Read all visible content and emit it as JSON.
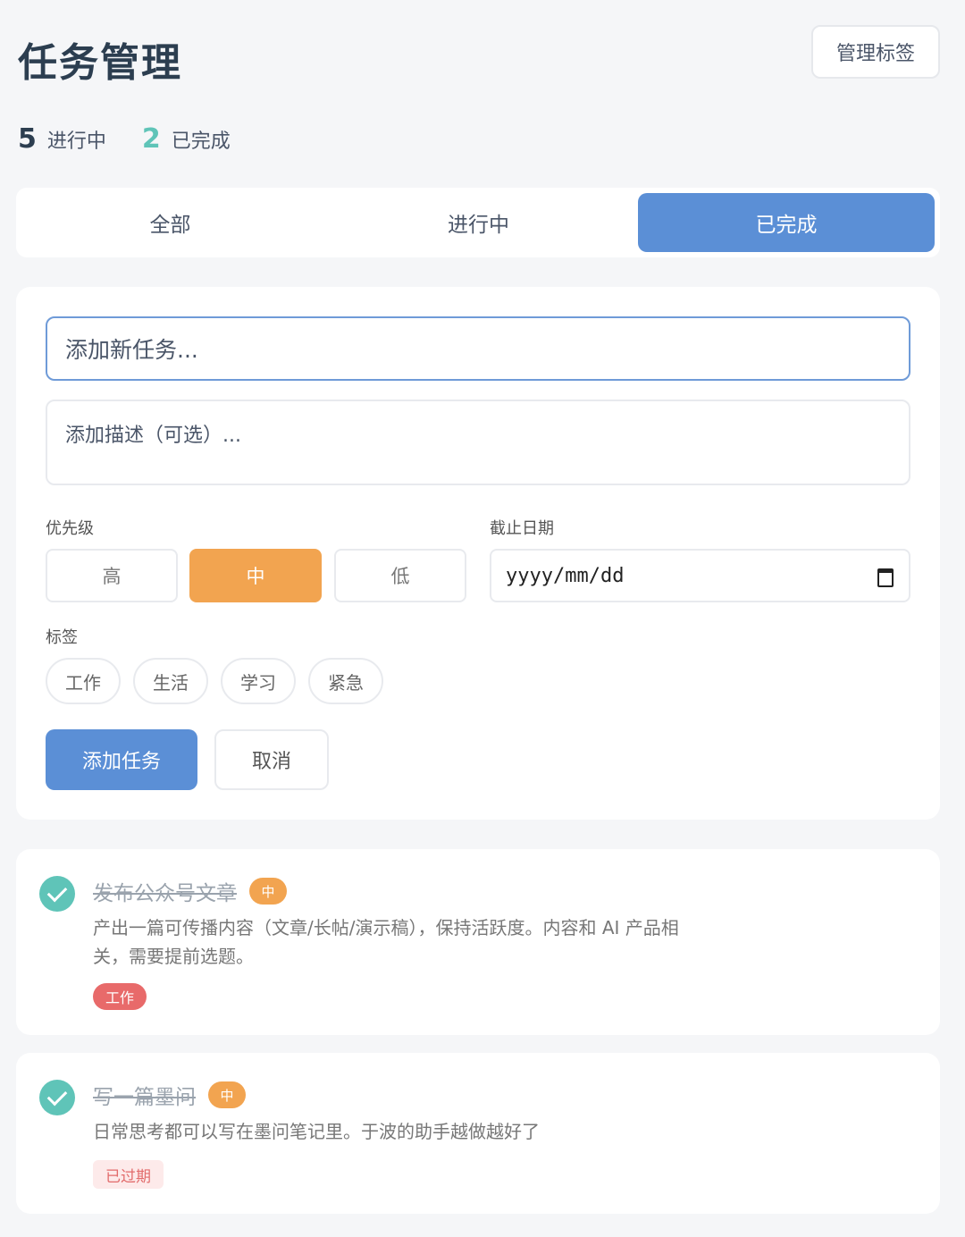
{
  "header": {
    "title": "任务管理",
    "manage_tags_label": "管理标签"
  },
  "stats": {
    "active_count": "5",
    "active_label": "进行中",
    "done_count": "2",
    "done_label": "已完成"
  },
  "filters": {
    "all": "全部",
    "active": "进行中",
    "done": "已完成",
    "selected": "已完成"
  },
  "form": {
    "title_placeholder": "添加新任务...",
    "desc_placeholder": "添加描述（可选）...",
    "priority_label": "优先级",
    "priority_options": [
      "高",
      "中",
      "低"
    ],
    "priority_selected": "中",
    "date_label": "截止日期",
    "date_placeholder": "yyyy/mm/dd",
    "tags_label": "标签",
    "tags": [
      "工作",
      "生活",
      "学习",
      "紧急"
    ],
    "add_label": "添加任务",
    "cancel_label": "取消"
  },
  "tasks": [
    {
      "title": "发布公众号文章",
      "priority": "中",
      "desc_line1": "产出一篇可传播内容（文章/长帖/演示稿），保持活跃度。内容和 AI 产品相",
      "desc_line2": "关，需要提前选题。",
      "tag": "工作",
      "completed": true
    },
    {
      "title": "写一篇墨问",
      "priority": "中",
      "desc_line1": "日常思考都可以写在墨问笔记里。于波的助手越做越好了",
      "status": "已过期",
      "completed": true
    }
  ],
  "colors": {
    "primary": "#5b8fd6",
    "priority_mid": "#f2a450",
    "done_teal": "#5fc4b8",
    "tag_work": "#e86a6a",
    "overdue_bg": "#fdeaea",
    "overdue_text": "#e26b6b"
  }
}
